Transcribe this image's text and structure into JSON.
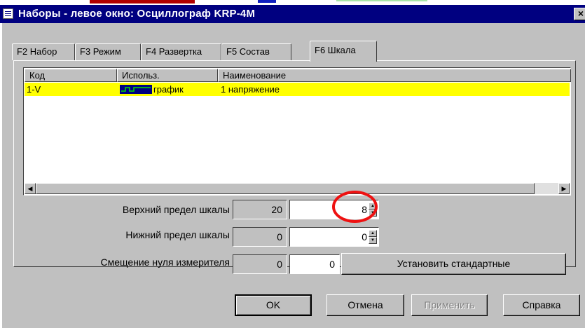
{
  "window": {
    "title": "Наборы - левое окно: Осциллограф KRP-4M",
    "close_glyph": "×"
  },
  "tabs": [
    {
      "label": "F2 Набор"
    },
    {
      "label": "F3 Режим"
    },
    {
      "label": "F4 Развертка"
    },
    {
      "label": "F5 Состав"
    },
    {
      "label": "F6 Шкала",
      "active": true
    }
  ],
  "list": {
    "columns": [
      "Код",
      "Использ.",
      "Наименование"
    ],
    "rows": [
      {
        "code": "1-V",
        "usage": "график",
        "usage_icon": "graph-icon",
        "name": "1 напряжение"
      }
    ],
    "selected_row_color": "#ffff00"
  },
  "scale": {
    "upper": {
      "label": "Верхний предел шкалы",
      "current": "20",
      "value": "8"
    },
    "lower": {
      "label": "Нижний предел шкалы",
      "current": "0",
      "value": "0"
    },
    "offset": {
      "label": "Смещение нуля измерителя",
      "current": "0",
      "value": "0"
    },
    "set_default_label": "Установить стандартные"
  },
  "buttons": {
    "ok": "OK",
    "cancel": "Отмена",
    "apply": "Применить",
    "help": "Справка"
  },
  "colors": {
    "titlebar": "#000080",
    "face": "#c0c0c0",
    "highlight_ring": "#ee1111"
  }
}
